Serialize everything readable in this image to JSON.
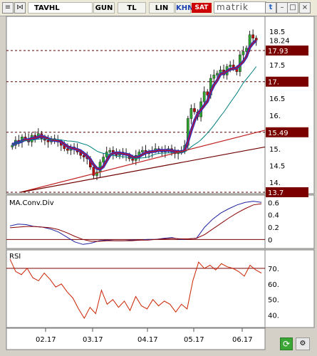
{
  "toolbar": {
    "symbol": "TAVHL",
    "buttons": [
      "GUN",
      "TL",
      "LIN",
      "KHN"
    ],
    "sat_label": "SAT",
    "brand": "matrik"
  },
  "chart_data": [
    {
      "type": "candlestick",
      "title": "",
      "x_tick_labels": [
        "02.17",
        "03.17",
        "04.17",
        "05.17",
        "06.17"
      ],
      "y_tick_labels": [
        "18.5",
        "18.24",
        "18.",
        "17.5",
        "17.",
        "16.5",
        "16.",
        "15.5",
        "15.",
        "14.5",
        "14."
      ],
      "ylim": [
        13.7,
        18.8
      ],
      "horizontal_levels": [
        {
          "value": 17.93,
          "label": "17.93"
        },
        {
          "value": 17.0,
          "label": "17."
        },
        {
          "value": 15.49,
          "label": "15.49"
        },
        {
          "value": 13.7,
          "label": "13.7"
        }
      ],
      "last_price": 18.24,
      "close_approx": [
        15.1,
        15.25,
        15.2,
        15.35,
        15.3,
        15.2,
        15.4,
        15.35,
        15.45,
        15.3,
        15.25,
        15.2,
        15.3,
        15.25,
        15.2,
        15.1,
        15.0,
        14.95,
        15.05,
        15.0,
        14.9,
        14.8,
        14.75,
        14.7,
        14.45,
        14.2,
        14.3,
        14.6,
        14.75,
        14.9,
        14.95,
        14.85,
        14.8,
        14.9,
        14.85,
        14.8,
        14.7,
        14.65,
        14.8,
        14.9,
        14.95,
        14.85,
        14.9,
        14.95,
        15.0,
        14.95,
        14.9,
        14.95,
        15.0,
        14.9,
        14.85,
        14.9,
        14.95,
        15.1,
        15.9,
        16.2,
        16.1,
        15.95,
        16.4,
        16.7,
        16.6,
        17.1,
        17.2,
        17.25,
        17.35,
        17.2,
        17.45,
        17.5,
        17.4,
        17.3,
        17.8,
        17.9,
        18.0,
        18.4,
        18.3,
        18.24
      ]
    },
    {
      "type": "line",
      "title": "MA.Conv.Div",
      "y_tick_labels": [
        "0.6",
        "0.4",
        "0.2",
        "0"
      ],
      "ylim": [
        -0.1,
        0.65
      ],
      "series": [
        {
          "name": "",
          "color": "#2020a0",
          "values": [
            0.22,
            0.25,
            0.24,
            0.21,
            0.2,
            0.17,
            0.12,
            0.04,
            -0.04,
            -0.08,
            -0.06,
            -0.02,
            -0.01,
            -0.02,
            -0.02,
            -0.01,
            -0.01,
            0.0,
            0.0,
            0.02,
            0.03,
            0.0,
            0.01,
            0.02,
            0.2,
            0.33,
            0.43,
            0.5,
            0.56,
            0.6,
            0.62,
            0.6
          ]
        },
        {
          "name": "",
          "color": "#8b0000",
          "values": [
            0.19,
            0.2,
            0.21,
            0.21,
            0.2,
            0.19,
            0.16,
            0.11,
            0.05,
            0.0,
            -0.03,
            -0.03,
            -0.02,
            -0.02,
            -0.02,
            -0.02,
            -0.01,
            -0.01,
            0.0,
            0.01,
            0.02,
            0.01,
            0.01,
            0.02,
            0.08,
            0.17,
            0.26,
            0.35,
            0.43,
            0.5,
            0.56,
            0.58
          ]
        }
      ],
      "zero_line": 0
    },
    {
      "type": "line",
      "title": "RSI",
      "y_tick_labels": [
        "70.",
        "60.",
        "50.",
        "40."
      ],
      "ylim": [
        33,
        80
      ],
      "reference_line": 70,
      "series": [
        {
          "name": "",
          "color": "#cc2200",
          "values": [
            76,
            68,
            66,
            70,
            64,
            62,
            67,
            63,
            58,
            60,
            55,
            51,
            44,
            38,
            45,
            41,
            56,
            47,
            50,
            45,
            49,
            43,
            52,
            46,
            44,
            50,
            46,
            49,
            47,
            42,
            47,
            44,
            62,
            74,
            70,
            72,
            69,
            73,
            71,
            70,
            68,
            65,
            72,
            69,
            67
          ]
        }
      ]
    }
  ]
}
